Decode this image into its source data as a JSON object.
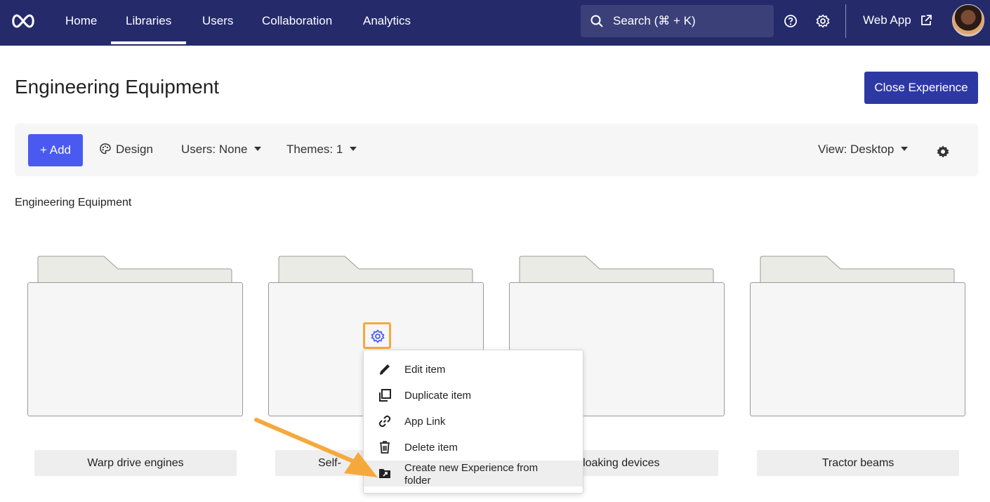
{
  "nav": {
    "items": [
      {
        "label": "Home"
      },
      {
        "label": "Libraries"
      },
      {
        "label": "Users"
      },
      {
        "label": "Collaboration"
      },
      {
        "label": "Analytics"
      }
    ],
    "active": "Libraries",
    "search_placeholder": "Search (⌘ + K)",
    "webapp_label": "Web App",
    "icons": [
      "infinity-logo-icon",
      "search-icon",
      "help-icon",
      "settings-icon",
      "external-link-icon"
    ]
  },
  "header": {
    "title": "Engineering Equipment",
    "close_button": "Close Experience"
  },
  "toolbar": {
    "add_label": "+ Add",
    "design_label": "Design",
    "users_label": "Users: None",
    "themes_label": "Themes: 1",
    "view_label": "View: Desktop"
  },
  "breadcrumb": "Engineering Equipment",
  "folders": [
    {
      "label": "Warp drive engines"
    },
    {
      "label": "Self-"
    },
    {
      "label": "Cloaking devices"
    },
    {
      "label": "Tractor beams"
    }
  ],
  "context_menu": {
    "items": [
      {
        "label": "Edit item",
        "icon": "pencil-icon"
      },
      {
        "label": "Duplicate item",
        "icon": "duplicate-icon"
      },
      {
        "label": "App Link",
        "icon": "link-icon"
      },
      {
        "label": "Delete item",
        "icon": "trash-icon"
      },
      {
        "label": "Create new Experience from folder",
        "icon": "folder-export-icon"
      }
    ],
    "highlighted": "Create new Experience from folder"
  },
  "colors": {
    "nav_bg": "#252a6b",
    "primary": "#2e38a3",
    "add_button": "#4a5af0",
    "highlight_border": "#f5a93d",
    "arrow": "#f5a93d"
  }
}
